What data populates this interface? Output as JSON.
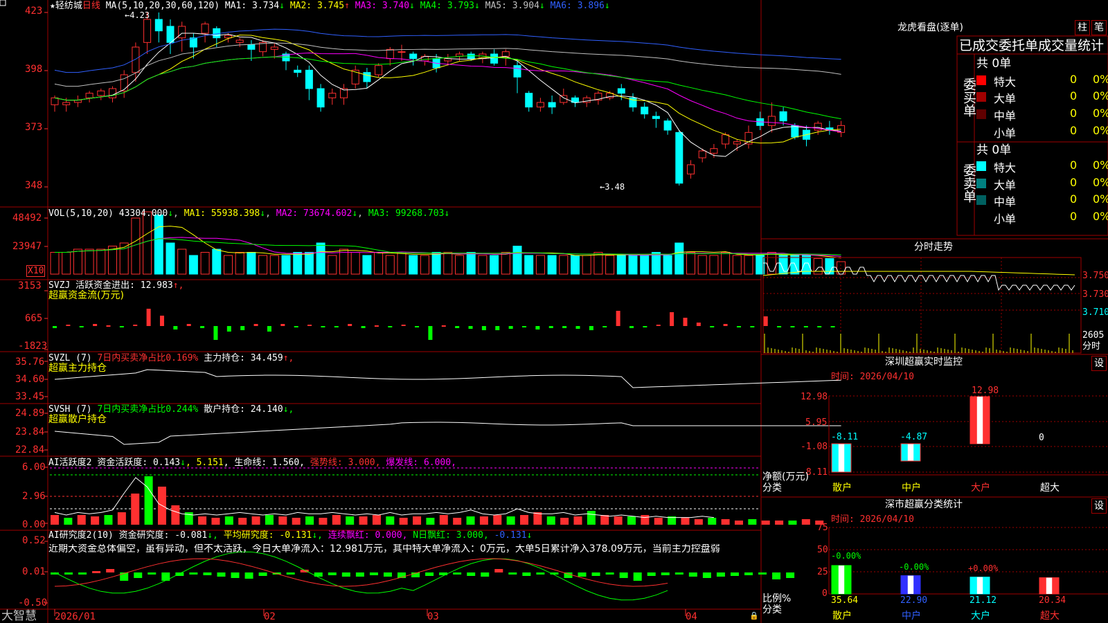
{
  "main": {
    "title_star": "★",
    "stock_name": "轻纺城",
    "period": "日线",
    "ma_prefix": "MA(5,10,20,30,60,120)",
    "ma": [
      {
        "label": "MA1: 3.734",
        "arrow": "↓",
        "color": "#ffffff"
      },
      {
        "label": "MA2: 3.745",
        "arrow": "↑",
        "color": "#ffff00"
      },
      {
        "label": "MA3: 3.740",
        "arrow": "↓",
        "color": "#ff00ff"
      },
      {
        "label": "MA4: 3.793",
        "arrow": "↓",
        "color": "#00ff00"
      },
      {
        "label": "MA5: 3.904",
        "arrow": "↓",
        "color": "#c0c0c0"
      },
      {
        "label": "MA6: 3.896",
        "arrow": "↓",
        "color": "#3060ff"
      }
    ],
    "price_ticks": [
      "423",
      "398",
      "373",
      "348"
    ],
    "high_marker": "4.23",
    "low_marker": "3.48",
    "x_dates": [
      "2026/01",
      "02",
      "03",
      "04"
    ]
  },
  "vol_panel": {
    "title": "VOL(5,10,20)",
    "value": "43304.000",
    "ma1": "MA1: 55938.398",
    "ma2": "MA2: 73674.602",
    "ma3": "MA3: 99268.703",
    "ticks": [
      "48492",
      "23947"
    ],
    "unit": "X10"
  },
  "svzj": {
    "title": "SVZJ  活跃资金进出: 12.983",
    "title_arrow": "↑,",
    "subtitle": "超赢资金流(万元)",
    "ticks": [
      "3153",
      "665",
      "-1823"
    ]
  },
  "svzl": {
    "prefix": "SVZL (7)",
    "middle": "7日内买卖净占比0.169%",
    "main_hold": "主力持仓: 34.459",
    "arrow": "↑,",
    "subtitle": "超赢主力持仓",
    "ticks": [
      "35.76",
      "34.60",
      "33.45"
    ]
  },
  "svsh": {
    "prefix": "SVSH (7)",
    "middle": "7日内买卖净占比0.244%",
    "retail_hold": "散户持仓: 24.140",
    "arrow": "↓,",
    "subtitle": "超赢散户持仓",
    "ticks": [
      "24.89",
      "23.84",
      "22.84"
    ]
  },
  "ai_active": {
    "prefix": "AI活跃度2",
    "fund_active": "资金活跃度: 0.143",
    "a1": "↓",
    "v2": ", 5.151",
    "life": ", 生命线: 1.560,",
    "strong": "强势线: 3.000,",
    "burst": "爆发线: 6.000,",
    "ticks": [
      "6.00",
      "2.96",
      "0.00"
    ]
  },
  "ai_research": {
    "prefix": "AI研究度2(10)",
    "research": "资金研究度: -0.081",
    "r_arrow": "↓,",
    "avg": "平均研究度: -0.131",
    "avg_arrow": "↓,",
    "red": "连续飘红: 0.000,",
    "nred": "N日飘红: 3.000,",
    "last": "-0.131",
    "last_arrow": "↓",
    "summary": "近期大资金总体偏空，虽有异动，但不太活跃，今日大单净流入：12.981万元，其中特大单净流入：0万元，大单5日累计净入378.09万元，当前主力控盘弱",
    "ticks": [
      "0.52",
      "0.01",
      "-0.50"
    ]
  },
  "footer": {
    "brand": "大智慧"
  },
  "dragon": {
    "title": "龙虎看盘(逐单)",
    "btn_column": "柱",
    "btn_stroke": "笔",
    "header": "已成交委托单成交量统计",
    "buy_label": "委买单",
    "sell_label": "委卖单",
    "buy_total": "共 0单",
    "sell_total": "共 0单",
    "buy_rows": [
      {
        "name": "特大",
        "count": "0",
        "pct": "0%",
        "color": "#ff0000"
      },
      {
        "name": "大单",
        "count": "0",
        "pct": "0%",
        "color": "#a00000"
      },
      {
        "name": "中单",
        "count": "0",
        "pct": "0%",
        "color": "#600000"
      },
      {
        "name": "小单",
        "count": "0",
        "pct": "0%",
        "color": "#000000"
      }
    ],
    "sell_rows": [
      {
        "name": "特大",
        "count": "0",
        "pct": "0%",
        "color": "#00ffff"
      },
      {
        "name": "大单",
        "count": "0",
        "pct": "0%",
        "color": "#008080"
      },
      {
        "name": "中单",
        "count": "0",
        "pct": "0%",
        "color": "#006060"
      },
      {
        "name": "小单",
        "count": "0",
        "pct": "0%",
        "color": "#000000"
      }
    ]
  },
  "minute": {
    "title": "分时走势",
    "ticks": [
      "3.750",
      "3.730",
      "3.710"
    ],
    "vol_tick": "2605",
    "vol_label": "分时"
  },
  "realtime": {
    "title": "深圳超赢实时监控",
    "settings": "设",
    "time": "时间: 2026/04/10",
    "ticks": [
      "12.98",
      "5.95",
      "-1.08",
      "-8.11"
    ],
    "y_label": "净额(万元)",
    "x_label": "分类",
    "categories": [
      "散户",
      "中户",
      "大户",
      "超大"
    ],
    "values": [
      "-8.11",
      "-4.87",
      "12.98",
      "0"
    ]
  },
  "category": {
    "title": "深市超赢分类统计",
    "settings": "设",
    "time": "时间: 2026/04/10",
    "ticks": [
      "75",
      "50",
      "25",
      "0"
    ],
    "y_label": "比例%",
    "x_label": "分类",
    "categories": [
      "散户",
      "中户",
      "大户",
      "超大"
    ],
    "changes": [
      "-0.00%",
      "-0.00%",
      "+0.00%",
      ""
    ],
    "values": [
      "35.64",
      "22.90",
      "21.12",
      "20.34"
    ]
  }
}
